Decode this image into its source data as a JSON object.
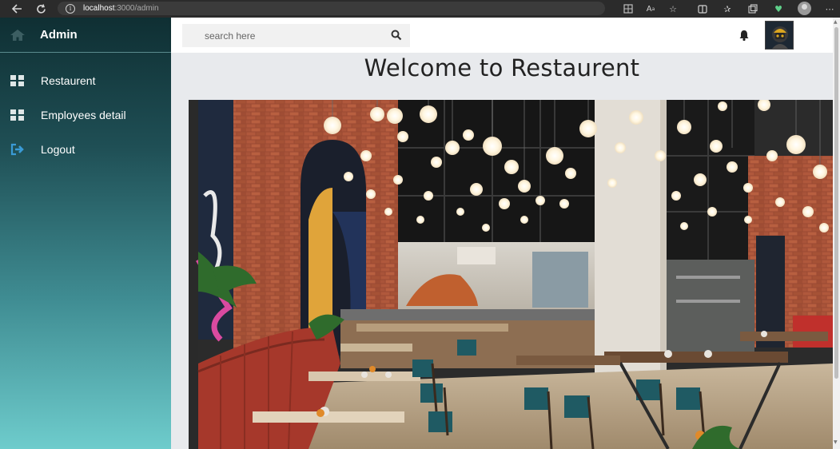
{
  "browser": {
    "url_host": "localhost",
    "url_path": ":3000/admin",
    "icons": [
      "back-icon",
      "reload-icon",
      "info-icon",
      "grid-icon",
      "read-aloud-icon",
      "favorite-icon",
      "split-screen-icon",
      "favorites-icon",
      "collections-icon",
      "heart-icon",
      "profile-icon",
      "more-icon"
    ]
  },
  "sidebar": {
    "title": "Admin",
    "items": [
      {
        "label": "Restaurent",
        "icon": "dashboard-icon"
      },
      {
        "label": "Employees detail",
        "icon": "dashboard-icon"
      },
      {
        "label": "Logout",
        "icon": "logout-icon"
      }
    ],
    "accent": "#1f4f55"
  },
  "topbar": {
    "search_placeholder": "search here",
    "search_icon": "search-icon",
    "bell_icon": "bell-icon",
    "avatar_icon": "avatar"
  },
  "main": {
    "title": "Welcome to Restaurent",
    "image_alt": "restaurant interior photo"
  }
}
